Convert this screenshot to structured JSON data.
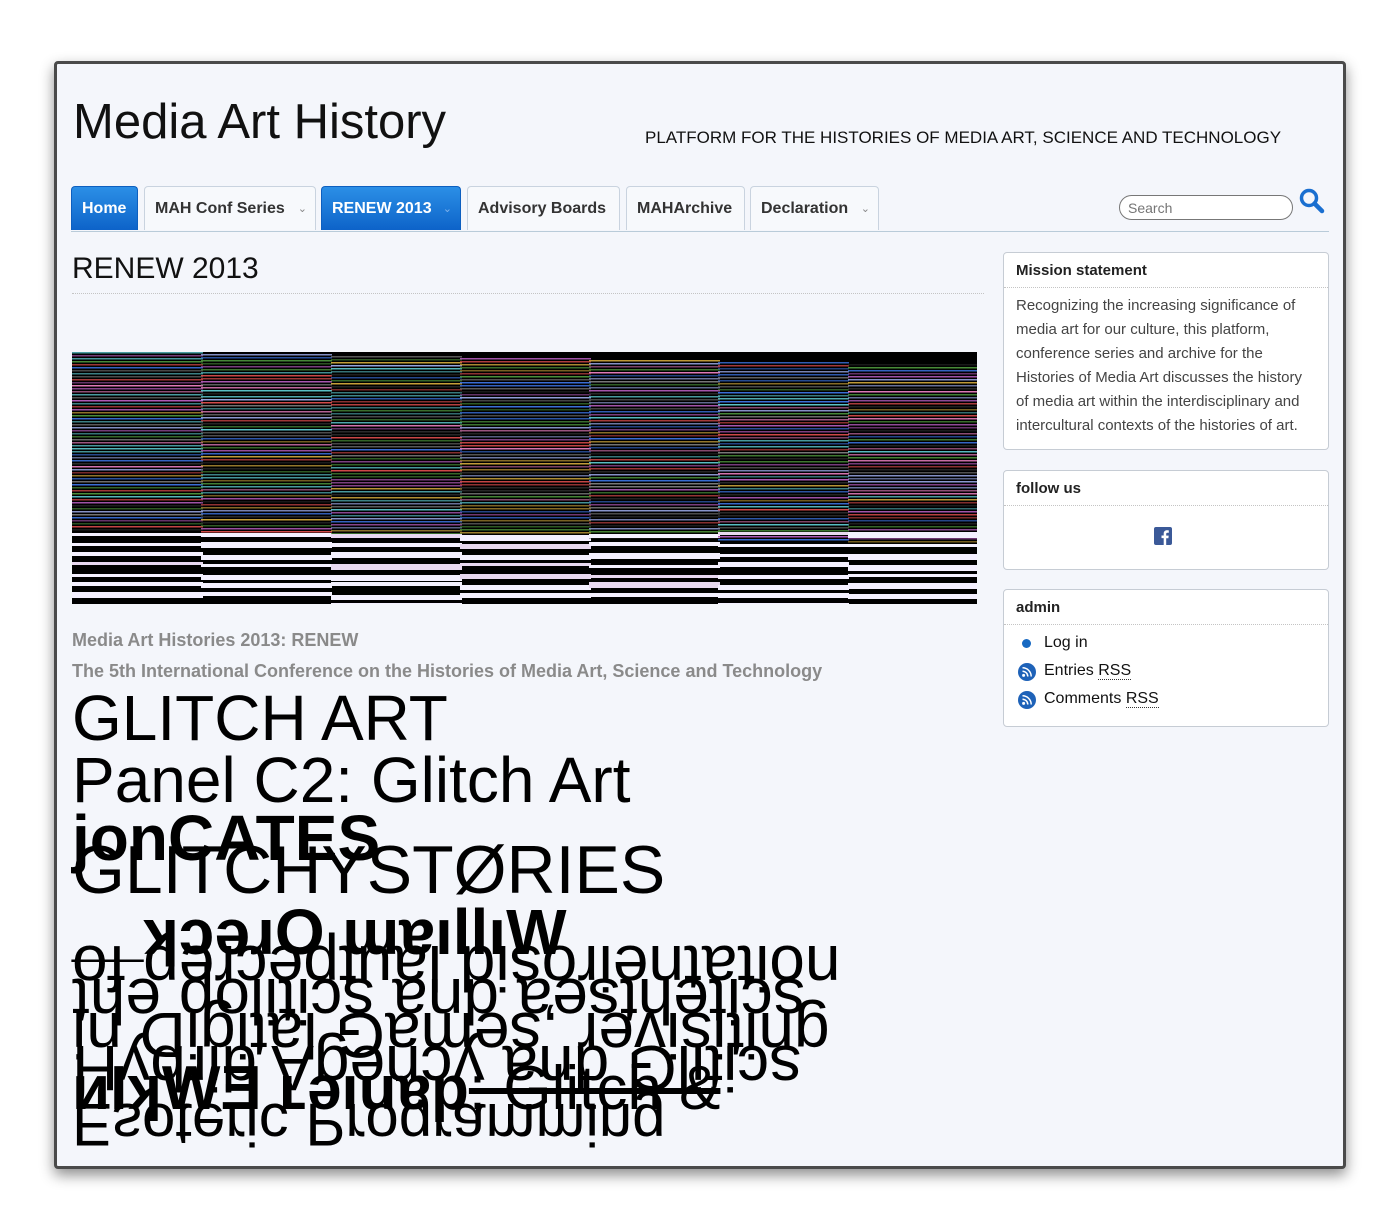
{
  "site": {
    "title": "Media Art History",
    "tagline": "PLATFORM FOR THE HISTORIES OF MEDIA ART, SCIENCE AND TECHNOLOGY"
  },
  "nav": {
    "home": "Home",
    "conf_series": "MAH Conf Series",
    "renew": "RENEW 2013",
    "advisory": "Advisory Boards",
    "archive": "MAHArchive",
    "declaration": "Declaration",
    "chevron": "⌄",
    "active_color": "#1a73d9"
  },
  "search": {
    "placeholder": "Search"
  },
  "page": {
    "title": "RENEW 2013",
    "subhead1": "Media Art Histories 2013: RENEW",
    "subhead2": "The 5th International Conference on the Histories of Media Art, Science and Technology"
  },
  "glitch": {
    "l1": "GLITCH ART",
    "l2": "Panel C2: Glitch Art",
    "l3": "jonCATES",
    "l4": "GLITCHYSTØRIES",
    "l5a": "__ʞɔǝɹO ɯɐıllıW",
    "l6": "noitatneirosid lautpecrep fo",
    "l7": "scitehtsea dna scitilop eht",
    "l8": "gnitisiver ,semaG latigiD ni",
    "l9": "scitilG dna ycnegA dirbyH",
    "l10a": "ᴎIʞWƎ ʟǝıuɐp",
    "l10b": ": Glitch &",
    "l11": "Esoteric Programming"
  },
  "sidebar": {
    "mission": {
      "title": "Mission statement",
      "text": "Recognizing the increasing significance of media art for our culture, this platform, conference series and archive for the Histories of Media Art discusses the history of media art within the interdisciplinary and intercultural contexts of the histories of art."
    },
    "follow": {
      "title": "follow us"
    },
    "admin": {
      "title": "admin",
      "login": "Log in",
      "entries": "Entries",
      "comments": "Comments",
      "rss": "RSS"
    }
  },
  "icons": [
    "search-icon",
    "facebook-icon",
    "rss-icon",
    "bullet-icon"
  ],
  "colors": {
    "accent": "#1a73d9",
    "subhead_gray": "#8a8a8a",
    "background": "#f4f6fb"
  }
}
